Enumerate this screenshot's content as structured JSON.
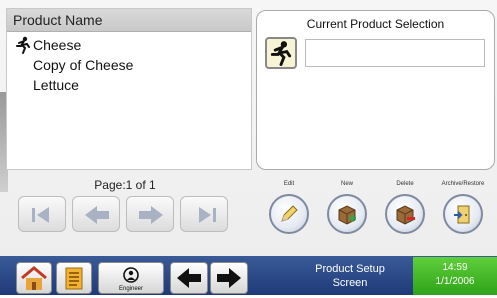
{
  "list": {
    "header": "Product Name",
    "items": [
      "Cheese",
      "Copy of Cheese",
      "Lettuce"
    ]
  },
  "selection": {
    "title": "Current Product Selection",
    "field_value": ""
  },
  "paging": {
    "label": "Page:1 of 1"
  },
  "actions": {
    "edit": "Edit",
    "new": "New",
    "delete": "Delete",
    "archive": "Archive/Restore"
  },
  "bottom": {
    "engineer": "Engineer",
    "screen_name_line1": "Product Setup",
    "screen_name_line2": "Screen",
    "time": "14:59",
    "date": "1/1/2006"
  },
  "colors": {
    "bar_blue": "#1f3a78",
    "clock_green": "#2fa31a",
    "list_header_gray": "#c9c9c9"
  },
  "icons": {
    "runner": "running-man-icon",
    "first": "first-page-icon",
    "prev": "previous-page-icon",
    "next": "next-page-icon",
    "last": "last-page-icon",
    "edit": "pencil-icon",
    "new": "new-box-icon",
    "delete": "delete-box-icon",
    "archive": "archive-door-icon",
    "home": "home-icon",
    "list": "list-icon",
    "engineer": "engineer-icon",
    "back": "back-arrow-icon",
    "forward": "forward-arrow-icon"
  }
}
